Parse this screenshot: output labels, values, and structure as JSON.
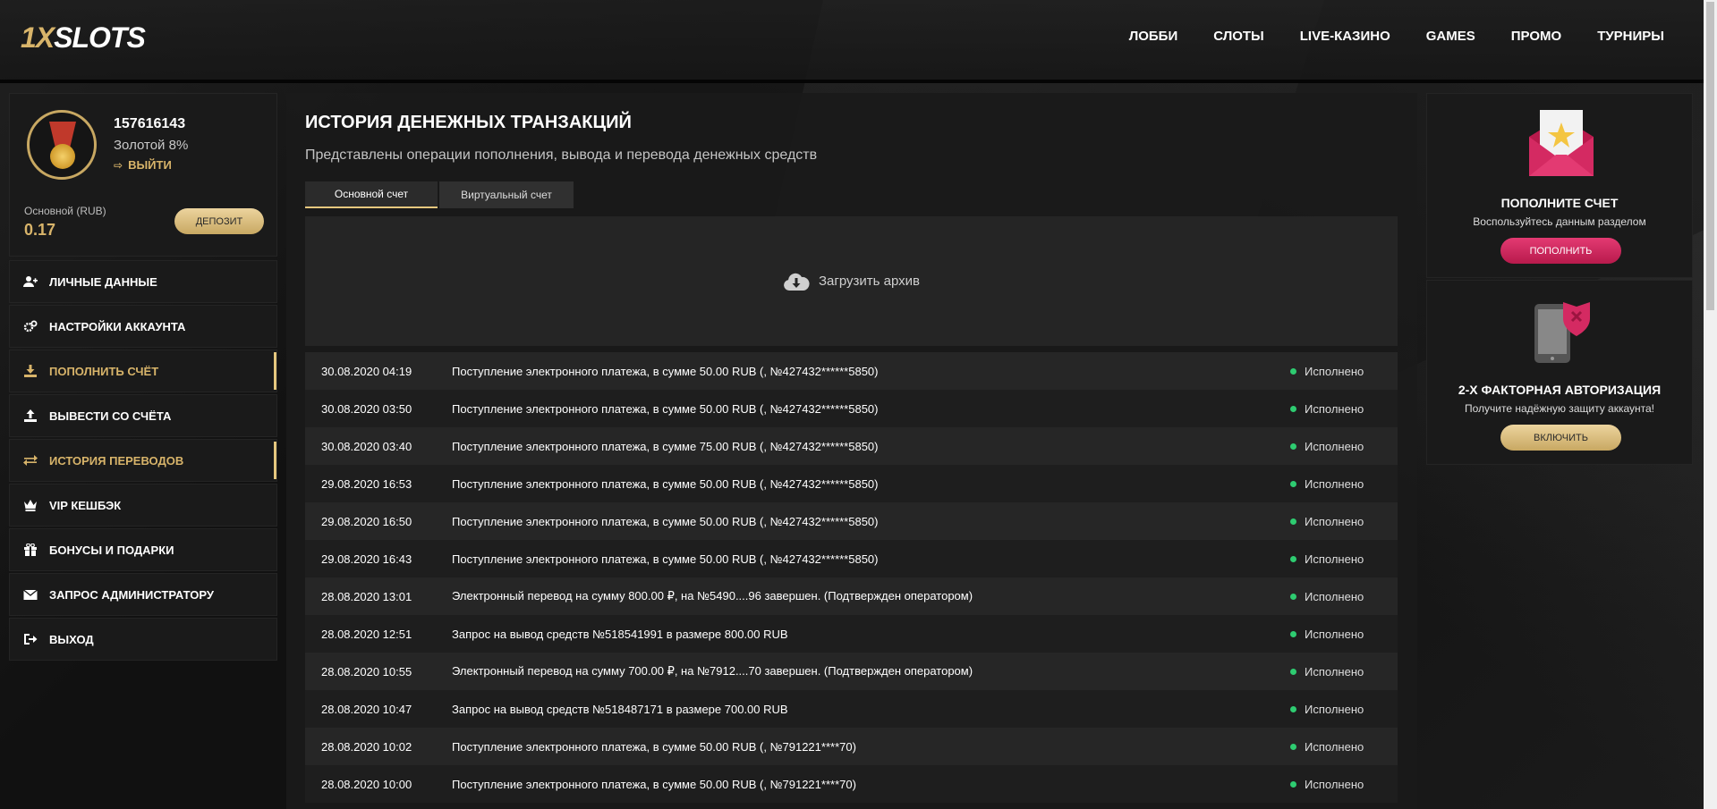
{
  "brand": {
    "logo_prefix": "1X",
    "logo_main": "SLOTS"
  },
  "nav": [
    "ЛОББИ",
    "СЛОТЫ",
    "LIVE-КАЗИНО",
    "GAMES",
    "ПРОМО",
    "ТУРНИРЫ"
  ],
  "profile": {
    "id": "157616143",
    "level": "Золотой 8%",
    "logout": "ВЫЙТИ",
    "account_label": "Основной (RUB)",
    "balance": "0.17",
    "deposit_button": "ДЕПОЗИТ"
  },
  "menu": [
    {
      "label": "ЛИЧНЫЕ ДАННЫЕ",
      "icon": "user-plus-icon"
    },
    {
      "label": "НАСТРОЙКИ АККАУНТА",
      "icon": "gears-icon"
    },
    {
      "label": "ПОПОЛНИТЬ СЧЁТ",
      "icon": "download-icon",
      "gold": true
    },
    {
      "label": "ВЫВЕСТИ СО СЧЁТА",
      "icon": "upload-icon"
    },
    {
      "label": "ИСТОРИЯ ПЕРЕВОДОВ",
      "icon": "exchange-icon",
      "gold": true
    },
    {
      "label": "VIP КЕШБЭК",
      "icon": "crown-icon"
    },
    {
      "label": "БОНУСЫ И ПОДАРКИ",
      "icon": "gift-icon"
    },
    {
      "label": "ЗАПРОС АДМИНИСТРАТОРУ",
      "icon": "envelope-icon"
    },
    {
      "label": "ВЫХОД",
      "icon": "sign-out-icon"
    }
  ],
  "main": {
    "title": "ИСТОРИЯ ДЕНЕЖНЫХ ТРАНЗАКЦИЙ",
    "subtitle": "Представлены операции пополнения, вывода и перевода денежных средств",
    "tabs": [
      "Основной счет",
      "Виртуальный счет"
    ],
    "archive_label": "Загрузить архив",
    "transactions": [
      {
        "date": "30.08.2020 04:19",
        "desc": "Поступление электронного платежа, в сумме 50.00 RUB (, №427432******5850)",
        "status": "Исполнено"
      },
      {
        "date": "30.08.2020 03:50",
        "desc": "Поступление электронного платежа, в сумме 50.00 RUB (, №427432******5850)",
        "status": "Исполнено"
      },
      {
        "date": "30.08.2020 03:40",
        "desc": "Поступление электронного платежа, в сумме 75.00 RUB (, №427432******5850)",
        "status": "Исполнено"
      },
      {
        "date": "29.08.2020 16:53",
        "desc": "Поступление электронного платежа, в сумме 50.00 RUB (, №427432******5850)",
        "status": "Исполнено"
      },
      {
        "date": "29.08.2020 16:50",
        "desc": "Поступление электронного платежа, в сумме 50.00 RUB (, №427432******5850)",
        "status": "Исполнено"
      },
      {
        "date": "29.08.2020 16:43",
        "desc": "Поступление электронного платежа, в сумме 50.00 RUB (, №427432******5850)",
        "status": "Исполнено"
      },
      {
        "date": "28.08.2020 13:01",
        "desc": "Электронный перевод на сумму 800.00 ₽, на №5490....96 завершен. (Подтвержден оператором)",
        "status": "Исполнено"
      },
      {
        "date": "28.08.2020 12:51",
        "desc": "Запрос на вывод средств №518541991 в размере 800.00 RUB",
        "status": "Исполнено"
      },
      {
        "date": "28.08.2020 10:55",
        "desc": "Электронный перевод на сумму 700.00 ₽, на №7912....70 завершен. (Подтвержден оператором)",
        "status": "Исполнено"
      },
      {
        "date": "28.08.2020 10:47",
        "desc": "Запрос на вывод средств №518487171 в размере 700.00 RUB",
        "status": "Исполнено"
      },
      {
        "date": "28.08.2020 10:02",
        "desc": "Поступление электронного платежа, в сумме 50.00 RUB (, №791221****70)",
        "status": "Исполнено"
      },
      {
        "date": "28.08.2020 10:00",
        "desc": "Поступление электронного платежа, в сумме 50.00 RUB (, №791221****70)",
        "status": "Исполнено"
      }
    ]
  },
  "widgets": {
    "deposit": {
      "title": "ПОПОЛНИТЕ СЧЕТ",
      "desc": "Воспользуйтесь данным разделом",
      "button": "ПОПОЛНИТЬ"
    },
    "twofa": {
      "title": "2-Х ФАКТОРНАЯ АВТОРИЗАЦИЯ",
      "desc": "Получите надёжную защиту аккаунта!",
      "button": "ВКЛЮЧИТЬ"
    }
  },
  "colors": {
    "gold": "#d8b46a",
    "pink": "#d42a62",
    "status_green": "#2ecc71"
  }
}
